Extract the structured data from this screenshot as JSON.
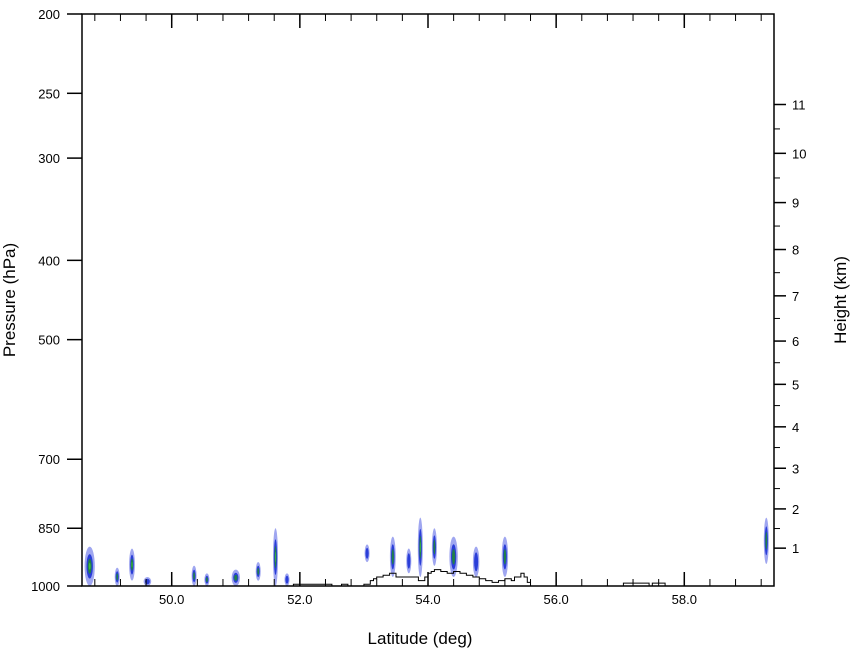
{
  "chart_data": {
    "type": "heatmap",
    "title": "",
    "xlabel": "Latitude (deg)",
    "ylabel_left": "Pressure (hPa)",
    "ylabel_right": "Height (km)",
    "xlim": [
      48.6,
      59.4
    ],
    "pressure_lim": [
      1000,
      200
    ],
    "pressure_scale": "log",
    "x_ticks": [
      "50.0",
      "52.0",
      "54.0",
      "56.0",
      "58.0"
    ],
    "x_tick_values": [
      50,
      52,
      54,
      56,
      58
    ],
    "x_minor_step": 0.4,
    "pressure_ticks": [
      "200",
      "250",
      "300",
      "400",
      "500",
      "700",
      "850",
      "1000"
    ],
    "pressure_tick_values": [
      200,
      250,
      300,
      400,
      500,
      700,
      850,
      1000
    ],
    "height_ticks": [
      "1",
      "2",
      "3",
      "4",
      "5",
      "6",
      "7",
      "8",
      "9",
      "10",
      "11"
    ],
    "height_tick_values": [
      1,
      2,
      3,
      4,
      5,
      6,
      7,
      8,
      9,
      10,
      11
    ],
    "height_scale_hpa": [
      899,
      805,
      718,
      639,
      567,
      502,
      442,
      388,
      340,
      296,
      258
    ],
    "grid": false,
    "legend": "none",
    "colors": {
      "low": "#9fa6f0",
      "mid": "#2a3ed8",
      "high": "#1f7f4a",
      "peak": "#3dbf3d",
      "terrain": "#000000"
    },
    "cells": [
      {
        "lat": 48.72,
        "p_top": 895,
        "p_bot": 1000,
        "w": 0.16,
        "level": 3
      },
      {
        "lat": 49.15,
        "p_top": 950,
        "p_bot": 1000,
        "w": 0.07,
        "level": 2
      },
      {
        "lat": 49.38,
        "p_top": 900,
        "p_bot": 985,
        "w": 0.09,
        "level": 3
      },
      {
        "lat": 49.62,
        "p_top": 975,
        "p_bot": 1000,
        "w": 0.12,
        "level": 1
      },
      {
        "lat": 50.35,
        "p_top": 945,
        "p_bot": 1000,
        "w": 0.06,
        "level": 2
      },
      {
        "lat": 50.55,
        "p_top": 965,
        "p_bot": 1000,
        "w": 0.06,
        "level": 2
      },
      {
        "lat": 51.0,
        "p_top": 955,
        "p_bot": 1000,
        "w": 0.13,
        "level": 2
      },
      {
        "lat": 51.35,
        "p_top": 935,
        "p_bot": 985,
        "w": 0.05,
        "level": 2
      },
      {
        "lat": 51.62,
        "p_top": 850,
        "p_bot": 1000,
        "w": 0.06,
        "level": 3
      },
      {
        "lat": 51.8,
        "p_top": 965,
        "p_bot": 1000,
        "w": 0.07,
        "level": 1
      },
      {
        "lat": 53.05,
        "p_top": 890,
        "p_bot": 935,
        "w": 0.06,
        "level": 1
      },
      {
        "lat": 53.45,
        "p_top": 870,
        "p_bot": 975,
        "w": 0.09,
        "level": 2
      },
      {
        "lat": 53.7,
        "p_top": 900,
        "p_bot": 965,
        "w": 0.07,
        "level": 1
      },
      {
        "lat": 53.88,
        "p_top": 825,
        "p_bot": 975,
        "w": 0.06,
        "level": 3
      },
      {
        "lat": 54.1,
        "p_top": 850,
        "p_bot": 945,
        "w": 0.06,
        "level": 2
      },
      {
        "lat": 54.4,
        "p_top": 870,
        "p_bot": 975,
        "w": 0.13,
        "level": 2
      },
      {
        "lat": 54.75,
        "p_top": 895,
        "p_bot": 975,
        "w": 0.1,
        "level": 1
      },
      {
        "lat": 55.2,
        "p_top": 870,
        "p_bot": 975,
        "w": 0.1,
        "level": 2
      },
      {
        "lat": 59.28,
        "p_top": 825,
        "p_bot": 940,
        "w": 0.05,
        "level": 2
      }
    ],
    "terrain": {
      "lat": [
        51.85,
        51.9,
        52.4,
        52.5,
        52.65,
        52.75,
        53.0,
        53.1,
        53.15,
        53.2,
        53.3,
        53.4,
        53.5,
        53.8,
        53.85,
        53.95,
        54.0,
        54.05,
        54.1,
        54.2,
        54.3,
        54.4,
        54.5,
        54.6,
        54.7,
        54.8,
        54.9,
        55.0,
        55.1,
        55.2,
        55.3,
        55.35,
        55.45,
        55.5,
        55.55,
        55.6
      ],
      "p": [
        1000,
        995,
        995,
        1000,
        995,
        1000,
        995,
        985,
        980,
        975,
        970,
        965,
        975,
        975,
        985,
        975,
        965,
        960,
        955,
        960,
        965,
        960,
        965,
        970,
        975,
        980,
        985,
        990,
        985,
        980,
        985,
        975,
        965,
        975,
        990,
        1000
      ],
      "patches": [
        [
          57.05,
          57.45,
          992
        ],
        [
          57.5,
          57.7,
          992
        ]
      ]
    }
  }
}
